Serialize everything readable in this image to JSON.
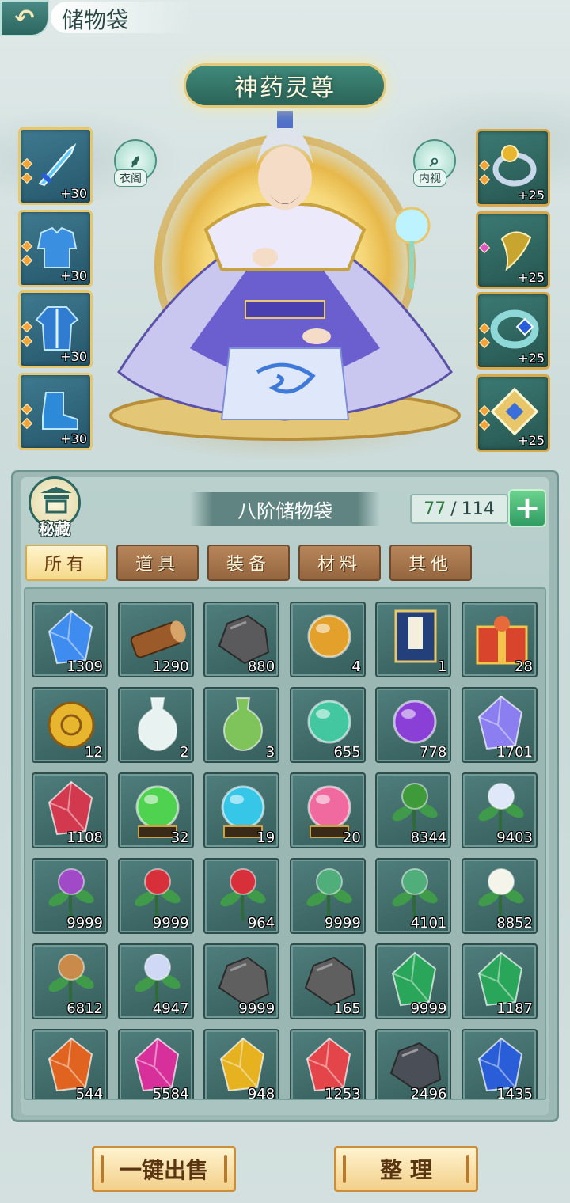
{
  "header": {
    "back_icon": "back-arrow-icon",
    "title": "储物袋"
  },
  "character": {
    "title": "神药灵尊",
    "wardrobe_label": "衣阁",
    "inspect_label": "内视"
  },
  "equipment_left": [
    {
      "name": "sword",
      "level": "+30"
    },
    {
      "name": "armor",
      "level": "+30"
    },
    {
      "name": "robe",
      "level": "+30"
    },
    {
      "name": "boots",
      "level": "+30"
    }
  ],
  "equipment_right": [
    {
      "name": "ring",
      "level": "+25"
    },
    {
      "name": "amulet",
      "level": "+25"
    },
    {
      "name": "bracelet",
      "level": "+25"
    },
    {
      "name": "talisman",
      "level": "+25"
    }
  ],
  "bag": {
    "secret_label": "秘藏",
    "name": "八阶储物袋",
    "capacity_used": "77",
    "capacity_sep": "/",
    "capacity_total": "114",
    "add_icon": "plus-icon"
  },
  "tabs": [
    {
      "label": "所有",
      "active": true
    },
    {
      "label": "道具",
      "active": false
    },
    {
      "label": "装备",
      "active": false
    },
    {
      "label": "材料",
      "active": false
    },
    {
      "label": "其他",
      "active": false
    }
  ],
  "items": [
    {
      "icon": "blue-crystal-icon",
      "count": "1309",
      "color": "#3f8cf0"
    },
    {
      "icon": "wood-log-icon",
      "count": "1290",
      "color": "#9a5a2a"
    },
    {
      "icon": "iron-ore-icon",
      "count": "880",
      "color": "#5a5a5c"
    },
    {
      "icon": "dragon-orb-icon",
      "count": "4",
      "color": "#e3a02a"
    },
    {
      "icon": "book-icon",
      "count": "1",
      "color": "#23407a"
    },
    {
      "icon": "gift-box-icon",
      "count": "28",
      "color": "#d9442c"
    },
    {
      "icon": "gold-medallion-icon",
      "count": "12",
      "color": "#e8b52e"
    },
    {
      "icon": "white-vase-icon",
      "count": "2",
      "color": "#e8f3f1"
    },
    {
      "icon": "green-gourd-icon",
      "count": "3",
      "color": "#7fc45a"
    },
    {
      "icon": "jade-orb-icon",
      "count": "655",
      "color": "#42c7a0"
    },
    {
      "icon": "purple-orb-icon",
      "count": "778",
      "color": "#8a3fd6"
    },
    {
      "icon": "violet-crystal-icon",
      "count": "1701",
      "color": "#8a7ef0"
    },
    {
      "icon": "red-crystal-icon",
      "count": "1108",
      "color": "#d2384e"
    },
    {
      "icon": "green-sphere-icon",
      "count": "32",
      "color": "#4fd24f"
    },
    {
      "icon": "cyan-sphere-icon",
      "count": "19",
      "color": "#36c7e8"
    },
    {
      "icon": "pink-sphere-icon",
      "count": "20",
      "color": "#f06aa0"
    },
    {
      "icon": "herb-leaves-icon",
      "count": "8344",
      "color": "#3f9a3a"
    },
    {
      "icon": "lotus-icon",
      "count": "9403",
      "color": "#dfe8f8"
    },
    {
      "icon": "purple-orchid-icon",
      "count": "9999",
      "color": "#a04ac8"
    },
    {
      "icon": "red-bud-flower-icon",
      "count": "9999",
      "color": "#d8303a"
    },
    {
      "icon": "red-bud-flower-icon",
      "count": "964",
      "color": "#d8303a"
    },
    {
      "icon": "spirit-herb-icon",
      "count": "9999",
      "color": "#4fae7a"
    },
    {
      "icon": "spirit-herb-icon",
      "count": "4101",
      "color": "#4fae7a"
    },
    {
      "icon": "white-flower-icon",
      "count": "8852",
      "color": "#f4f4ea"
    },
    {
      "icon": "ginseng-root-icon",
      "count": "6812",
      "color": "#c98a4a"
    },
    {
      "icon": "ice-lotus-icon",
      "count": "4947",
      "color": "#cfd8f4"
    },
    {
      "icon": "grey-stone-icon",
      "count": "9999",
      "color": "#5f5f60"
    },
    {
      "icon": "grey-stone-icon",
      "count": "165",
      "color": "#5f5f60"
    },
    {
      "icon": "emerald-crystal-icon",
      "count": "9999",
      "color": "#2aa65a"
    },
    {
      "icon": "emerald-crystal-icon",
      "count": "1187",
      "color": "#2aa65a"
    },
    {
      "icon": "amber-crystal-icon",
      "count": "544",
      "color": "#e0641f"
    },
    {
      "icon": "magenta-crystal-icon",
      "count": "5584",
      "color": "#d8309a"
    },
    {
      "icon": "gold-crystal-icon",
      "count": "948",
      "color": "#e6b21f"
    },
    {
      "icon": "red-shard-icon",
      "count": "1253",
      "color": "#e4454a"
    },
    {
      "icon": "dark-ore-icon",
      "count": "2496",
      "color": "#4a4e56"
    },
    {
      "icon": "sapphire-icon",
      "count": "1435",
      "color": "#2a5ed8"
    }
  ],
  "actions": {
    "sell_all_label": "一键出售",
    "sort_label": "整 理"
  }
}
